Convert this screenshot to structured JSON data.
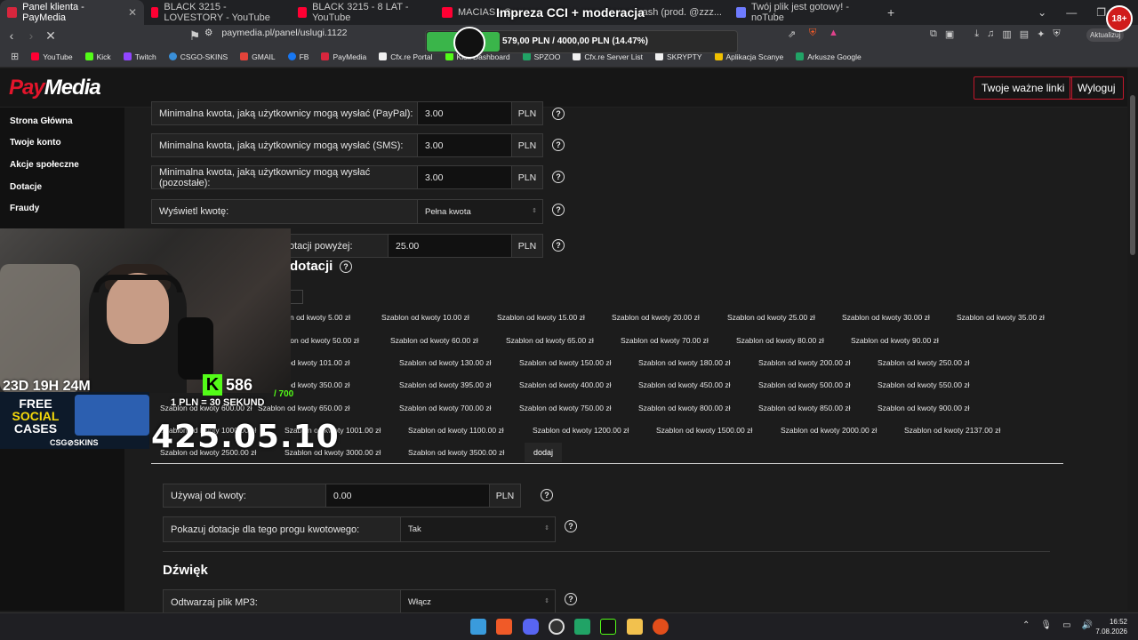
{
  "browser": {
    "tabs": [
      {
        "title": "Panel klienta - PayMedia",
        "active": true,
        "color": "#d7263d"
      },
      {
        "title": "BLACK 3215 - LOVESTORY - YouTube",
        "color": "#ff0033"
      },
      {
        "title": "BLACK 3215 - 8 LAT - YouTube",
        "color": "#ff0033"
      },
      {
        "title": "MACIAS - C... ",
        "color": "#ff0033"
      },
      {
        "title": "...ash (prod. @zzz...",
        "color": "#7a5cff"
      },
      {
        "title": "Twój plik jest gotowy! - noTube",
        "color": "#6e7bff"
      }
    ],
    "url": "paymedia.pl/panel/uslugi.1122",
    "update_label": "Aktualizuj",
    "bookmarks": [
      {
        "label": "YouTube",
        "color": "#ff0033"
      },
      {
        "label": "Kick",
        "color": "#53fc18"
      },
      {
        "label": "Twitch",
        "color": "#9146ff"
      },
      {
        "label": "CSGO-SKINS",
        "color": "#3a8fd8"
      },
      {
        "label": "GMAIL",
        "color": "#e4433a"
      },
      {
        "label": "FB",
        "color": "#1877f2"
      },
      {
        "label": "PayMedia",
        "color": "#d7263d"
      },
      {
        "label": "Cfx.re Portal",
        "color": "#f0f0f0"
      },
      {
        "label": "Kick Dashboard",
        "color": "#53fc18"
      },
      {
        "label": "SPZOO",
        "color": "#21a366"
      },
      {
        "label": "Cfx.re Server List",
        "color": "#f0f0f0"
      },
      {
        "label": "SKRYPTY",
        "color": "#f0f0f0"
      },
      {
        "label": "Aplikacja Scanye",
        "color": "#f0c000"
      },
      {
        "label": "Arkusze Google",
        "color": "#21a366"
      }
    ]
  },
  "stream_overlay": {
    "goal_title": "Impreza CCI + moderacja",
    "goal_amount": "579,00 PLN / 4000,00 PLN (14.47%)",
    "goal_fraction": 0.1447,
    "age_badge": "18+",
    "kick_count": "586",
    "kick_goal": "/ 700",
    "rate": "1 PLN = 30 SEKUND",
    "timer_small": "23D 19H 24M",
    "timer_big": "425.05.10",
    "promo_line1": "FREE",
    "promo_line2": "SOCIAL",
    "promo_line3": "CASES",
    "promo_brand": "CSG⊘SKINS"
  },
  "site": {
    "logo_pay": "Pay",
    "logo_media": "Media",
    "links_button": "Twoje ważne linki",
    "logout_button": "Wyloguj",
    "sidebar": [
      "Strona Główna",
      "Twoje konto",
      "Akcje społeczne",
      "Dotacje",
      "Fraudy"
    ]
  },
  "form": {
    "min_paypal": {
      "label": "Minimalna kwota, jaką użytkownicy mogą wysłać (PayPal):",
      "value": "3.00",
      "unit": "PLN"
    },
    "min_sms": {
      "label": "Minimalna kwota, jaką użytkownicy mogą wysłać (SMS):",
      "value": "3.00",
      "unit": "PLN"
    },
    "min_other": {
      "label": "Minimalna kwota, jaką użytkownicy mogą wysłać (pozostałe):",
      "value": "3.00",
      "unit": "PLN"
    },
    "show_amount": {
      "label": "Wyświetl kwotę:",
      "value": "Pełna kwota"
    },
    "donation_above": {
      "label": "otacji powyżej:",
      "value": "25.00",
      "unit": "PLN"
    },
    "section_title": "dotacji",
    "templates": [
      [
        "Szablon od kwoty 5.00 zł",
        "Szablon od kwoty 10.00 zł",
        "Szablon od kwoty 15.00 zł",
        "Szablon od kwoty 20.00 zł",
        "Szablon od kwoty 25.00 zł",
        "Szablon od kwoty 30.00 zł",
        "Szablon od kwoty 35.00 zł"
      ],
      [
        "Szablon od kwoty 50.00 zł",
        "Szablon od kwoty 60.00 zł",
        "Szablon od kwoty 65.00 zł",
        "Szablon od kwoty 70.00 zł",
        "Szablon od kwoty 80.00 zł",
        "Szablon od kwoty 90.00 zł"
      ],
      [
        "Szablon od kwoty 101.00 zł",
        "Szablon od kwoty 130.00 zł",
        "Szablon od kwoty 150.00 zł",
        "Szablon od kwoty 180.00 zł",
        "Szablon od kwoty 200.00 zł",
        "Szablon od kwoty 250.00 zł"
      ],
      [
        "Szablon od kwoty 350.00 zł",
        "Szablon od kwoty 395.00 zł",
        "Szablon od kwoty 400.00 zł",
        "Szablon od kwoty 450.00 zł",
        "Szablon od kwoty 500.00 zł",
        "Szablon od kwoty 550.00 zł"
      ],
      [
        "Szablon od kwoty 600.00 zł",
        "Szablon od kwoty 650.00 zł",
        "Szablon od kwoty 700.00 zł",
        "Szablon od kwoty 750.00 zł",
        "Szablon od kwoty 800.00 zł",
        "Szablon od kwoty 850.00 zł",
        "Szablon od kwoty 900.00 zł"
      ],
      [
        "Szablon od kwoty 1000.00 zł",
        "Szablon od kwoty 1001.00 zł",
        "Szablon od kwoty 1100.00 zł",
        "Szablon od kwoty 1200.00 zł",
        "Szablon od kwoty 1500.00 zł",
        "Szablon od kwoty 2000.00 zł",
        "Szablon od kwoty 2137.00 zł"
      ],
      [
        "Szablon od kwoty 2500.00 zł",
        "Szablon od kwoty 3000.00 zł",
        "Szablon od kwoty 3500.00 zł"
      ]
    ],
    "add_button": "dodaj",
    "use_from": {
      "label": "Używaj od kwoty:",
      "value": "0.00",
      "unit": "PLN"
    },
    "show_donations": {
      "label": "Pokazuj dotacje dla tego progu kwotowego:",
      "value": "Tak"
    },
    "sound_title": "Dźwięk",
    "play_mp3": {
      "label": "Odtwarzaj plik MP3:",
      "value": "Włącz"
    },
    "help_glyph": "?"
  },
  "taskbar": {
    "time": "16:52",
    "date": "7.08.2026"
  }
}
